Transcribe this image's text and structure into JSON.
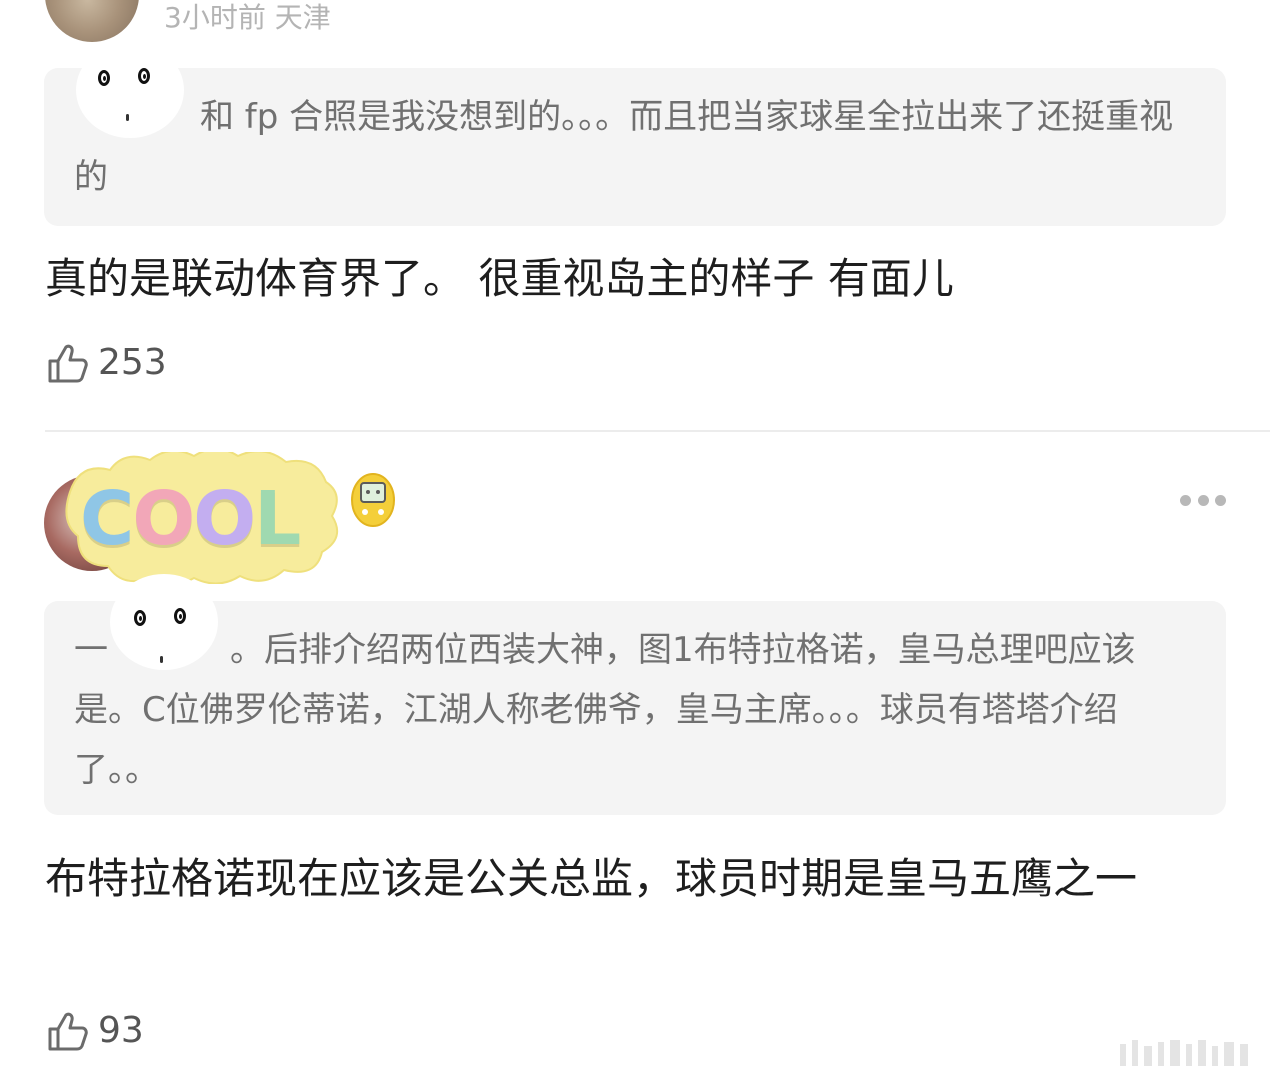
{
  "comments": [
    {
      "meta": "3小时前 天津",
      "quote": "和 fp 合照是我没想到的。。。而且把当家球星全拉出来了还挺重视的",
      "text": "真的是联动体育界了。 很重视岛主的样子  有面儿",
      "likes": "253",
      "like_icon": "thumbs-up-icon"
    },
    {
      "avatar_badge": "COOL",
      "badge_letters": [
        "C",
        "O",
        "O",
        "L"
      ],
      "quote_lead": "一",
      "quote_tail": "。后排介绍两位西装大神，图1布特拉格诺，皇马总理吧应该是。C位佛罗伦蒂诺，江湖人称老佛爷，皇马主席。。。球员有塔塔介绍了。。",
      "text": "布特拉格诺现在应该是公关总监，球员时期是皇马五鹰之一",
      "likes": "93",
      "like_icon": "thumbs-up-icon",
      "more_icon": "more-dots-icon"
    }
  ],
  "colors": {
    "quote_bg": "#f4f4f4",
    "meta_text": "#b4b4b4",
    "quote_text": "#707070",
    "body_text": "#1e1e1e",
    "badge_c": "#8fc6e6",
    "badge_o1": "#f2a7b8",
    "badge_o2": "#c3aef0",
    "badge_l": "#9fd9b0",
    "blob": "#f7ec9c"
  }
}
